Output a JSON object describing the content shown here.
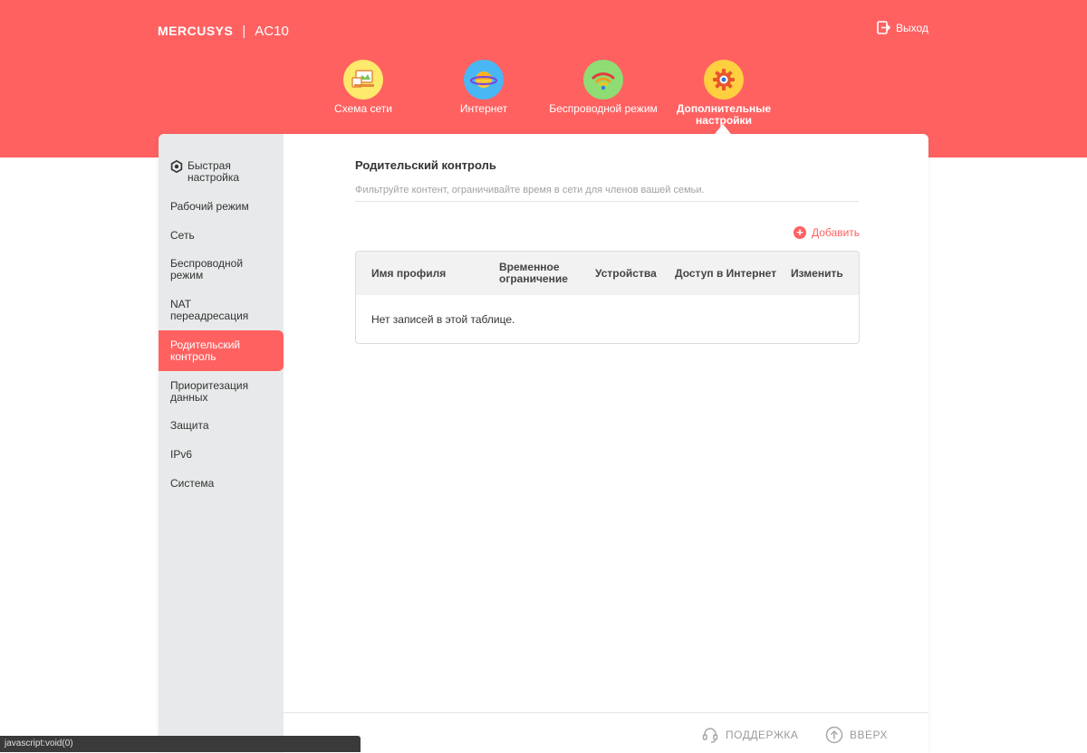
{
  "header": {
    "brand": "MERCUSYS",
    "separator": "|",
    "model": "AC10",
    "logout_label": "Выход"
  },
  "nav": [
    {
      "label": "Схема сети",
      "icon": "network-map-icon",
      "active": false
    },
    {
      "label": "Интернет",
      "icon": "planet-icon",
      "active": false
    },
    {
      "label": "Беспроводной режим",
      "icon": "wifi-icon",
      "active": false
    },
    {
      "label": "Дополнительные настройки",
      "icon": "gear-icon",
      "active": true
    }
  ],
  "sidebar": {
    "items": [
      {
        "label": "Быстрая настройка",
        "icon": "quick-setup-icon"
      },
      {
        "label": "Рабочий режим"
      },
      {
        "label": "Сеть"
      },
      {
        "label": "Беспроводной режим"
      },
      {
        "label": "NAT переадресация"
      },
      {
        "label": "Родительский контроль",
        "active": true
      },
      {
        "label": "Приоритезация данных"
      },
      {
        "label": "Защита"
      },
      {
        "label": "IPv6"
      },
      {
        "label": "Система"
      }
    ]
  },
  "main": {
    "title": "Родительский контроль",
    "description": "Фильтруйте контент, ограничивайте время в сети для членов вашей семьи.",
    "add_label": "Добавить",
    "table": {
      "columns": [
        "Имя профиля",
        "Временное ограничение",
        "Устройства",
        "Доступ в Интернет",
        "Изменить"
      ],
      "empty_message": "Нет записей в этой таблице."
    }
  },
  "footer": {
    "support_label": "ПОДДЕРЖКА",
    "top_label": "ВВЕРХ"
  },
  "statusbar": {
    "text": "javascript:void(0)"
  },
  "colors": {
    "accent": "#ff6161",
    "sidebar_bg": "#e8e9ea",
    "nav_circle_1": "#fde96b",
    "nav_circle_2": "#49b7f3",
    "nav_circle_3": "#8fdc74",
    "nav_circle_4": "#fecf3e"
  }
}
